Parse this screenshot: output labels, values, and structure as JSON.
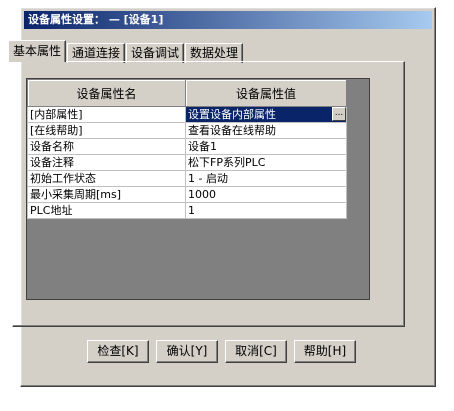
{
  "window": {
    "title": "设备属性设置： — [设备1]"
  },
  "tabs": [
    {
      "label": "基本属性"
    },
    {
      "label": "通道连接"
    },
    {
      "label": "设备调试"
    },
    {
      "label": "数据处理"
    }
  ],
  "grid": {
    "headers": [
      "设备属性名",
      "设备属性值"
    ],
    "rows": [
      {
        "name": "[内部属性]",
        "value": "设置设备内部属性",
        "has_button": true,
        "button_label": "..."
      },
      {
        "name": "[在线帮助]",
        "value": "查看设备在线帮助"
      },
      {
        "name": "设备名称",
        "value": "设备1"
      },
      {
        "name": "设备注释",
        "value": "松下FP系列PLC"
      },
      {
        "name": "初始工作状态",
        "value": "1 - 启动"
      },
      {
        "name": "最小采集周期[ms]",
        "value": "1000"
      },
      {
        "name": "PLC地址",
        "value": "1"
      }
    ]
  },
  "buttons": {
    "check": "检查[K]",
    "ok": "确认[Y]",
    "cancel": "取消[C]",
    "help": "帮助[H]"
  },
  "colors": {
    "face": "#d4d0c8",
    "selection": "#0a246a",
    "title_start": "#0a246a"
  }
}
